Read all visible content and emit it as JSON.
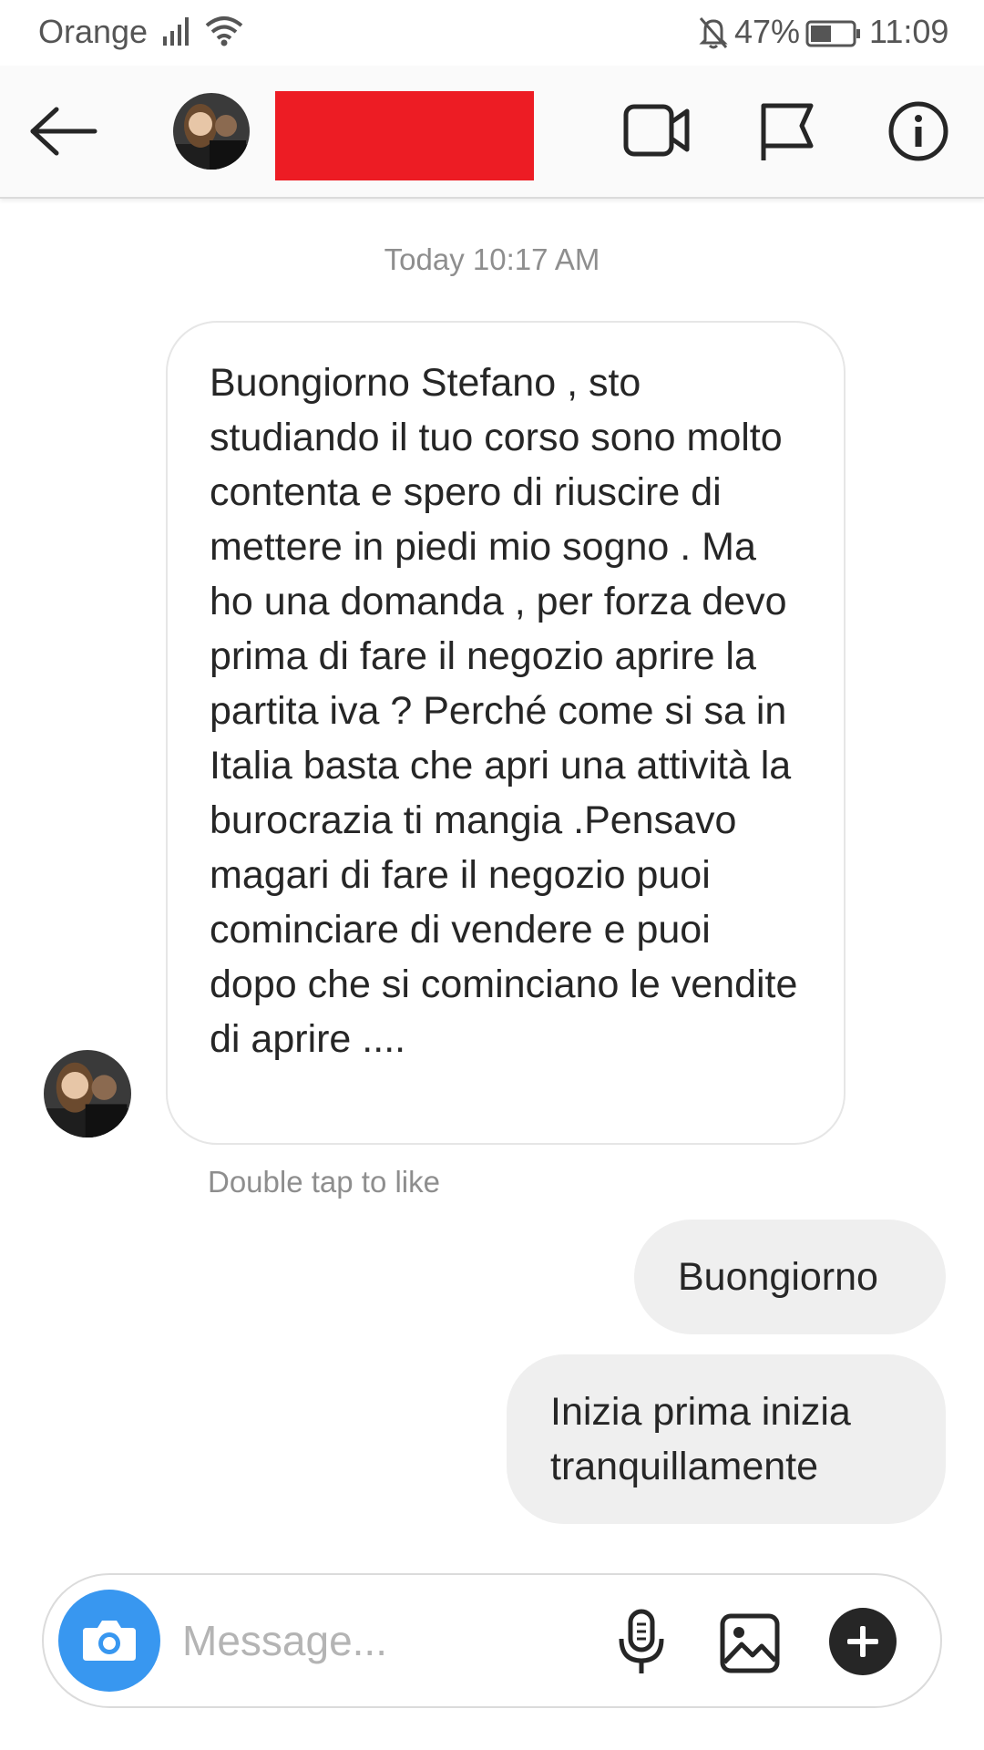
{
  "status_bar": {
    "carrier": "Orange",
    "battery": "47%",
    "time": "11:09",
    "icons": [
      "signal-icon",
      "wifi-icon",
      "bell-off-icon",
      "battery-icon"
    ]
  },
  "header": {
    "back_icon": "arrow-left-icon",
    "actions": [
      "video-call-icon",
      "flag-icon",
      "info-icon"
    ]
  },
  "conversation": {
    "timestamp": "Today 10:17 AM",
    "incoming": {
      "text": "Buongiorno Stefano , sto studiando il tuo corso sono molto contenta e spero di riuscire di mettere in piedi mio sogno . Ma ho una domanda , per forza devo prima di fare il negozio aprire la partita iva ? Perché come si sa in Italia basta che apri una attività la burocrazia ti mangia .Pensavo magari di fare il negozio puoi cominciare di vendere e puoi dopo che si cominciano le vendite di aprire ....",
      "hint": "Double tap to like"
    },
    "outgoing": [
      {
        "text": "Buongiorno"
      },
      {
        "text": "Inizia prima inizia tranquillamente"
      }
    ]
  },
  "composer": {
    "placeholder": "Message...",
    "value": "",
    "icons": [
      "camera-icon",
      "microphone-icon",
      "gallery-icon",
      "plus-icon"
    ]
  },
  "colors": {
    "accent": "#3897f0",
    "redaction": "#ed1c24",
    "bubble_outgoing": "#efefef",
    "text": "#262626",
    "muted": "#8e8e8e"
  }
}
